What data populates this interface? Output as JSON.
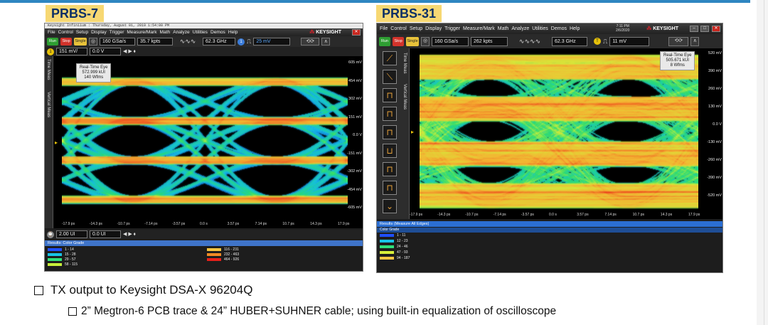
{
  "panels": [
    {
      "title": "PRBS-7",
      "caption": "Keysight Infiniium : Thursday, August 01, 2019 1:54:00 PM",
      "menu": [
        "File",
        "Control",
        "Setup",
        "Display",
        "Trigger",
        "Measure/Mark",
        "Math",
        "Analyze",
        "Utilities",
        "Demos",
        "Help"
      ],
      "brand": "KEYSIGHT",
      "toolbar": {
        "run": "Run",
        "stop": "Stop",
        "single": "Single",
        "sample_rate": "160 GSa/s",
        "memory": "35.7 kpts",
        "bandwidth": "62.3 GHz",
        "trigger_level": "25 mV"
      },
      "channel": {
        "scale": "151 mV/",
        "offset": "0.0 V"
      },
      "side_labels": [
        "Time Meas",
        "Vertical Meas"
      ],
      "info": {
        "title": "Real-Time Eye",
        "count": "572.999 kUI",
        "waveforms": "140 Wfms"
      },
      "y_labels": [
        "605 mV",
        "454 mV",
        "302 mV",
        "151 mV",
        "0.0 V",
        "-151 mV",
        "-302 mV",
        "-454 mV",
        "-605 mV"
      ],
      "x_labels": [
        "-17.9 ps",
        "-14.3 ps",
        "-10.7 ps",
        "-7.14 ps",
        "-3.57 ps",
        "0.0 s",
        "3.57 ps",
        "7.14 ps",
        "10.7 ps",
        "14.3 ps",
        "17.9 ps"
      ],
      "horizontal": {
        "scale": "2.00 UI",
        "position": "0.0 UI"
      },
      "results_header": "Results: Color Grade",
      "color_grade": [
        {
          "range": "1 - 14",
          "color": "#1f4fff"
        },
        {
          "range": "15 - 28",
          "color": "#17c3e6"
        },
        {
          "range": "29 - 57",
          "color": "#2fe07a"
        },
        {
          "range": "58 - 115",
          "color": "#c8f03a"
        },
        {
          "range": "116 - 231",
          "color": "#f5c542"
        },
        {
          "range": "232 - 463",
          "color": "#f08a24"
        },
        {
          "range": "464 - 926",
          "color": "#e8201a"
        }
      ]
    },
    {
      "title": "PRBS-31",
      "clock": {
        "time": "7:11 PM",
        "date": "2/6/2020"
      },
      "menu": [
        "File",
        "Control",
        "Setup",
        "Display",
        "Trigger",
        "Measure/Mark",
        "Math",
        "Analyze",
        "Utilities",
        "Demos",
        "Help"
      ],
      "brand": "KEYSIGHT",
      "toolbar": {
        "run": "Run",
        "stop": "Stop",
        "single": "Single",
        "sample_rate": "160 GSa/s",
        "memory": "262 kpts",
        "bandwidth": "62.3 GHz",
        "trigger_level": "11 mV"
      },
      "side_labels": [
        "Time Meas",
        "Vertical Meas"
      ],
      "info": {
        "title": "Real-Time Eye",
        "count": "505.671 kUI",
        "waveforms": "8 Wfms"
      },
      "y_labels": [
        "520 mV",
        "390 mV",
        "260 mV",
        "130 mV",
        "0.0 V",
        "-130 mV",
        "-260 mV",
        "-390 mV",
        "-520 mV"
      ],
      "x_labels": [
        "-17.9 ps",
        "-14.3 ps",
        "-10.7 ps",
        "-7.14 ps",
        "-3.57 ps",
        "0.0 s",
        "3.57 ps",
        "7.14 ps",
        "10.7 ps",
        "14.3 ps",
        "17.9 ps"
      ],
      "results_header": "Results  (Measure All Edges)",
      "color_grade_label": "Color Grade",
      "color_grade": [
        {
          "range": "1 - 11",
          "color": "#1f4fff"
        },
        {
          "range": "12 - 23",
          "color": "#17c3e6"
        },
        {
          "range": "24 - 46",
          "color": "#2fe07a"
        },
        {
          "range": "47 - 93",
          "color": "#d8f03a"
        },
        {
          "range": "94 - 187",
          "color": "#f5c542"
        }
      ]
    }
  ],
  "bullets": [
    {
      "text": "TX output to Keysight DSA-X 96204Q"
    },
    {
      "text": "2” Megtron-6 PCB trace & 24” HUBER+SUHNER cable;  using built-in equalization of oscilloscope"
    }
  ]
}
